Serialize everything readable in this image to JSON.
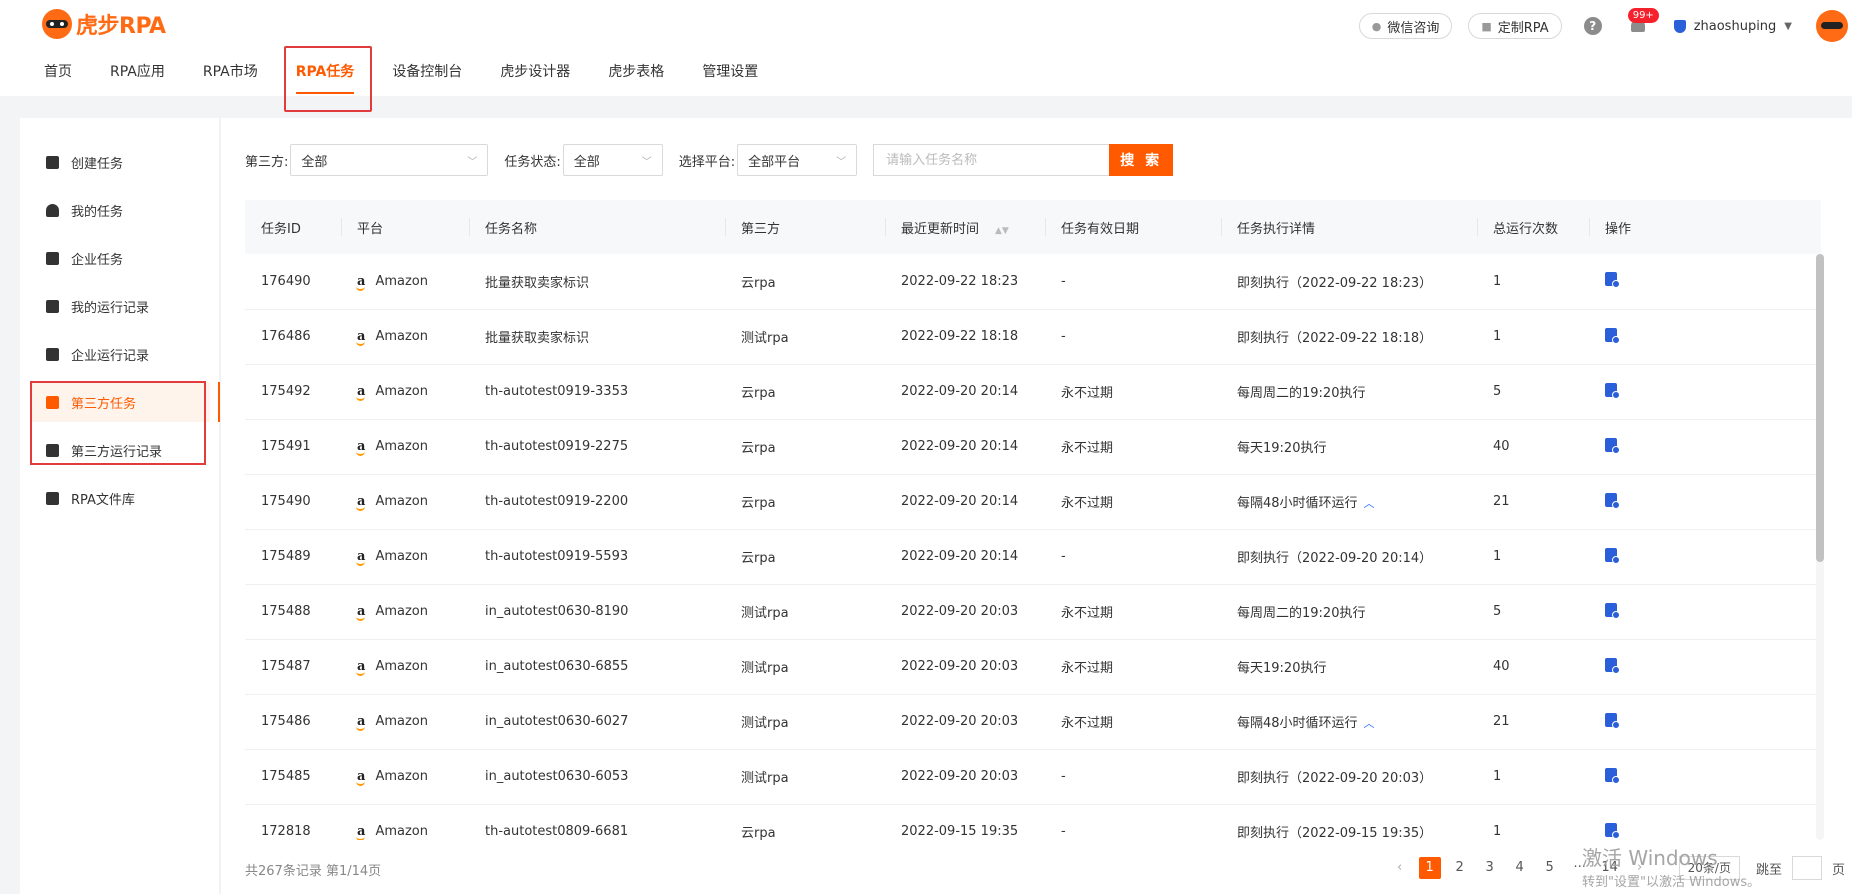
{
  "app": {
    "logo_text": "虎步RPA"
  },
  "nav": {
    "items": [
      "首页",
      "RPA应用",
      "RPA市场",
      "RPA任务",
      "设备控制台",
      "虎步设计器",
      "虎步表格",
      "管理设置"
    ],
    "active": "RPA任务"
  },
  "topbar": {
    "wechat": "微信咨询",
    "custom_rpa": "定制RPA",
    "help": "?",
    "notifications": "99+",
    "username": "zhaoshuping"
  },
  "sidebar": {
    "items": [
      "创建任务",
      "我的任务",
      "企业任务",
      "我的运行记录",
      "企业运行记录",
      "第三方任务",
      "第三方运行记录",
      "RPA文件库"
    ],
    "active": "第三方任务"
  },
  "filters": {
    "third_party_label": "第三方:",
    "third_party_value": "全部",
    "status_label": "任务状态:",
    "status_value": "全部",
    "platform_label": "选择平台:",
    "platform_value": "全部平台",
    "search_placeholder": "请输入任务名称",
    "search_button": "搜 索"
  },
  "table": {
    "columns": [
      "任务ID",
      "平台",
      "任务名称",
      "第三方",
      "最近更新时间",
      "任务有效日期",
      "任务执行详情",
      "总运行次数",
      "操作"
    ],
    "platform_logo": "a",
    "rows": [
      [
        "176490",
        "Amazon",
        "批量获取卖家标识",
        "云rpa",
        "2022-09-22 18:23",
        "-",
        "即刻执行（2022-09-22 18:23）",
        "1"
      ],
      [
        "176486",
        "Amazon",
        "批量获取卖家标识",
        "测试rpa",
        "2022-09-22 18:18",
        "-",
        "即刻执行（2022-09-22 18:18）",
        "1"
      ],
      [
        "175492",
        "Amazon",
        "th-autotest0919-3353",
        "云rpa",
        "2022-09-20 20:14",
        "永不过期",
        "每周周二的19:20执行",
        "5"
      ],
      [
        "175491",
        "Amazon",
        "th-autotest0919-2275",
        "云rpa",
        "2022-09-20 20:14",
        "永不过期",
        "每天19:20执行",
        "40"
      ],
      [
        "175490",
        "Amazon",
        "th-autotest0919-2200",
        "云rpa",
        "2022-09-20 20:14",
        "永不过期",
        "每隔48小时循环运行",
        "21"
      ],
      [
        "175489",
        "Amazon",
        "th-autotest0919-5593",
        "云rpa",
        "2022-09-20 20:14",
        "-",
        "即刻执行（2022-09-20 20:14）",
        "1"
      ],
      [
        "175488",
        "Amazon",
        "in_autotest0630-8190",
        "测试rpa",
        "2022-09-20 20:03",
        "永不过期",
        "每周周二的19:20执行",
        "5"
      ],
      [
        "175487",
        "Amazon",
        "in_autotest0630-6855",
        "测试rpa",
        "2022-09-20 20:03",
        "永不过期",
        "每天19:20执行",
        "40"
      ],
      [
        "175486",
        "Amazon",
        "in_autotest0630-6027",
        "测试rpa",
        "2022-09-20 20:03",
        "永不过期",
        "每隔48小时循环运行",
        "21"
      ],
      [
        "175485",
        "Amazon",
        "in_autotest0630-6053",
        "测试rpa",
        "2022-09-20 20:03",
        "-",
        "即刻执行（2022-09-20 20:03）",
        "1"
      ],
      [
        "172818",
        "Amazon",
        "th-autotest0809-6681",
        "云rpa",
        "2022-09-15 19:35",
        "-",
        "即刻执行（2022-09-15 19:35）",
        "1"
      ]
    ],
    "expandable_rows": [
      4,
      8
    ]
  },
  "footer": {
    "total": "共267条记录 第1/14页",
    "pages": [
      "1",
      "2",
      "3",
      "4",
      "5",
      "···",
      "14"
    ],
    "current_page": "1",
    "page_size": "20条/页",
    "jump_label": "跳至",
    "page_suffix": "页"
  },
  "watermark": {
    "line1": "激活 Windows",
    "line2": "转到\"设置\"以激活 Windows。"
  },
  "colors": {
    "accent": "#ff5a00",
    "highlight_border": "#e23b3b",
    "link_blue": "#2b6bff"
  }
}
